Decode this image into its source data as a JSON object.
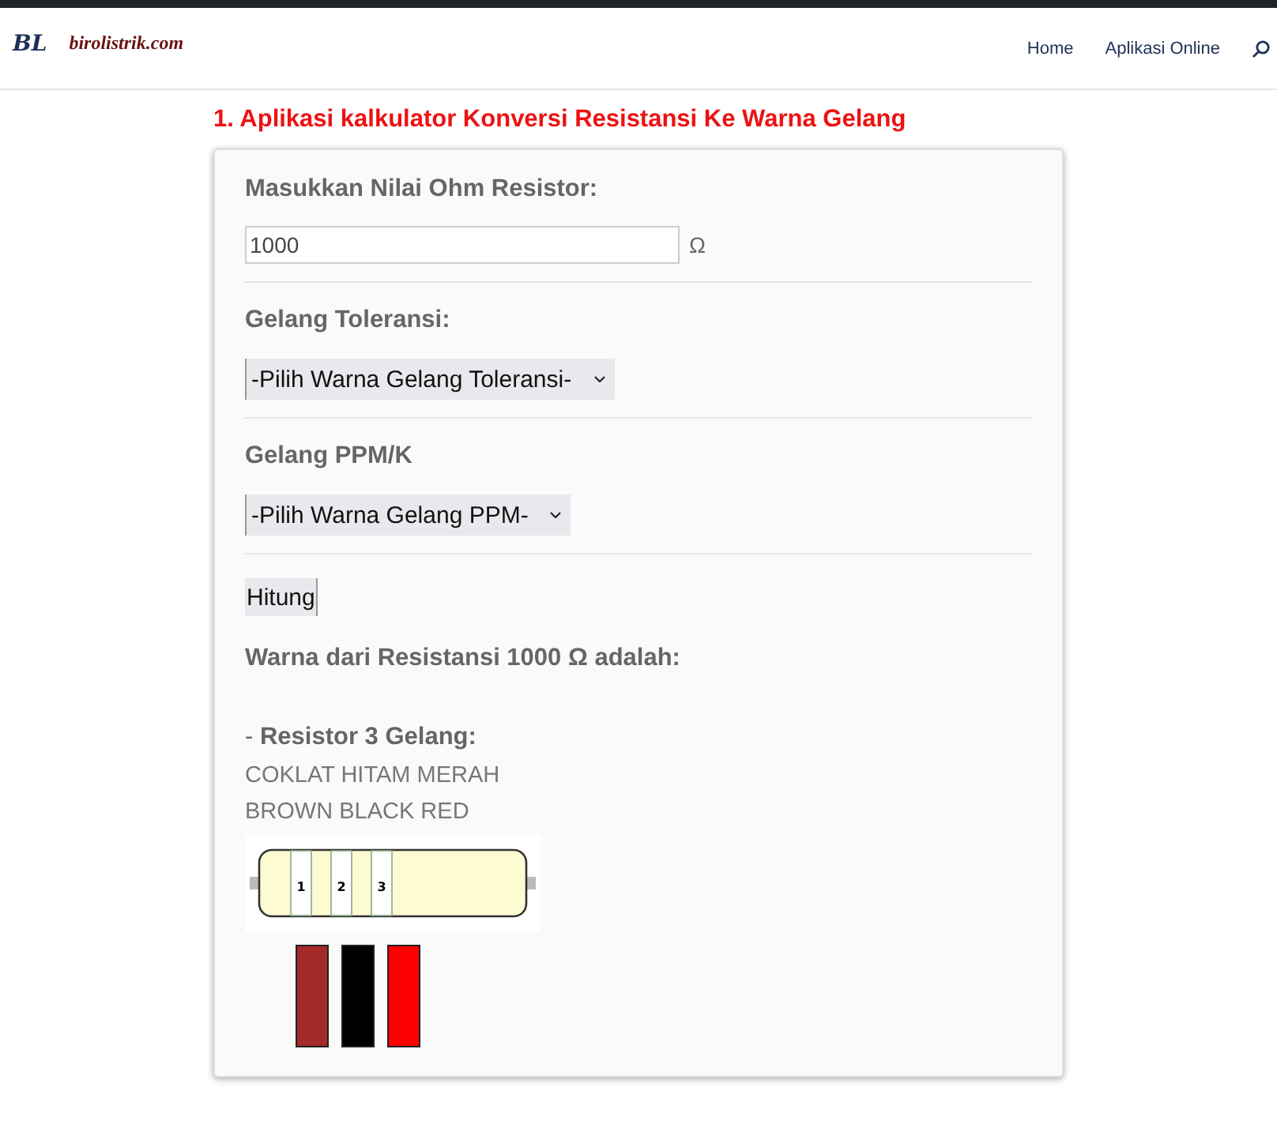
{
  "header": {
    "logo_mark": "BL",
    "site_name": "birolistrik.com",
    "nav": [
      "Home",
      "Aplikasi Online"
    ]
  },
  "title": "1. Aplikasi kalkulator Konversi Resistansi Ke Warna Gelang",
  "form": {
    "ohm_label": "Masukkan Nilai Ohm Resistor:",
    "ohm_value": "1000",
    "ohm_unit": "Ω",
    "tolerance_label": "Gelang Toleransi:",
    "tolerance_select": "-Pilih Warna Gelang Toleransi-",
    "ppm_label": "Gelang PPM/K",
    "ppm_select": "-Pilih Warna Gelang PPM-",
    "button": "Hitung"
  },
  "result": {
    "heading": "Warna dari Resistansi 1000 Ω adalah:",
    "subheading": "- **Resistor 3 Gelang:**",
    "names_id": "COKLAT HITAM MERAH",
    "names_en": "BROWN BLACK RED",
    "band_numbers": [
      "1",
      "2",
      "3"
    ],
    "bands": [
      {
        "color": "#a52a2a"
      },
      {
        "color": "#000000"
      },
      {
        "color": "#ff0000"
      }
    ]
  }
}
